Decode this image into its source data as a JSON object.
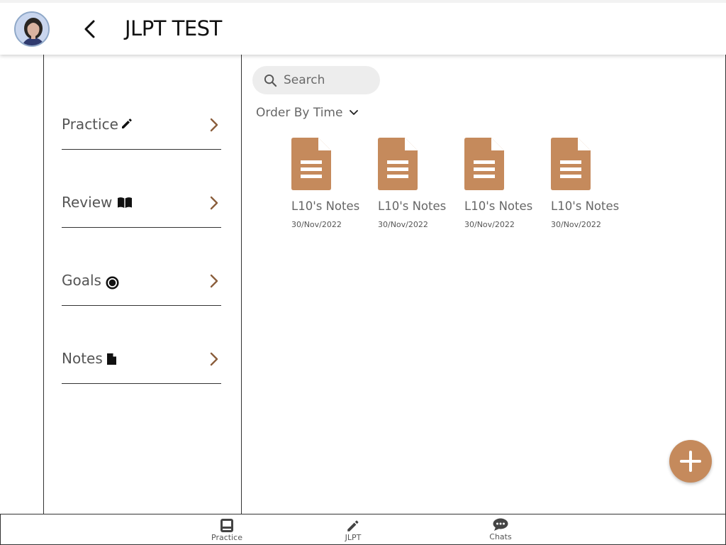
{
  "header": {
    "title": "JLPT TEST",
    "avatar": "user-avatar",
    "back_icon": "chevron-left-icon"
  },
  "sidebar": {
    "items": [
      {
        "label": "Practice",
        "icon": "pencil-icon"
      },
      {
        "label": "Review",
        "icon": "open-book-icon"
      },
      {
        "label": "Goals",
        "icon": "target-icon"
      },
      {
        "label": "Notes",
        "icon": "document-icon"
      }
    ]
  },
  "main": {
    "search": {
      "placeholder": "Search",
      "value": ""
    },
    "order_by": "Order By Time",
    "notes": [
      {
        "title": "L10's Notes",
        "date": "30/Nov/2022"
      },
      {
        "title": "L10's Notes",
        "date": "30/Nov/2022"
      },
      {
        "title": "L10's Notes",
        "date": "30/Nov/2022"
      },
      {
        "title": "L10's Notes",
        "date": "30/Nov/2022"
      }
    ]
  },
  "fab": {
    "icon": "plus-icon"
  },
  "bottom_nav": {
    "items": [
      {
        "label": "Practice",
        "icon": "book-icon"
      },
      {
        "label": "JLPT",
        "icon": "pencil-icon"
      },
      {
        "label": "Chats",
        "icon": "chat-bubble-icon"
      }
    ]
  },
  "colors": {
    "accent": "#c58a5c",
    "chevron": "#8b5e3c",
    "text_muted": "#666666",
    "search_bg": "#ededed"
  }
}
